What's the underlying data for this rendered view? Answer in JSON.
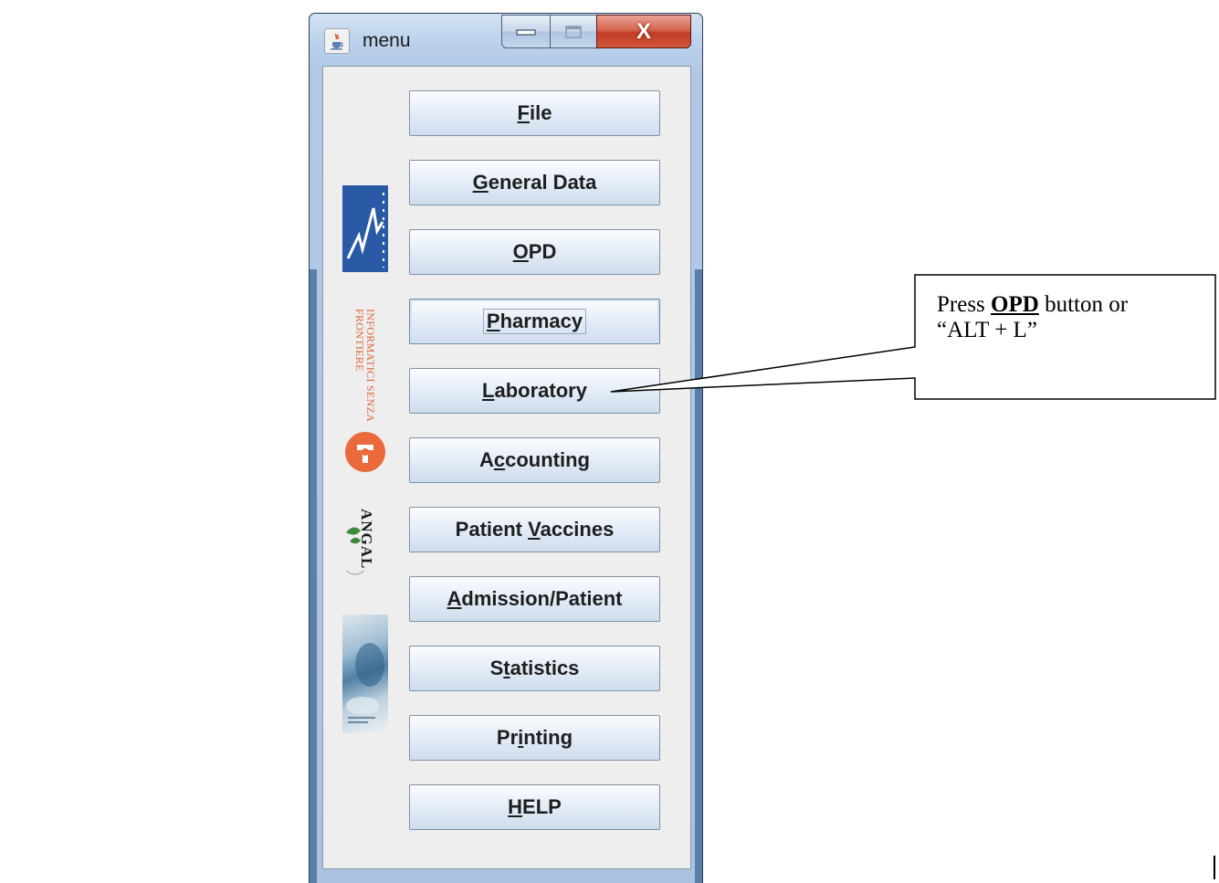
{
  "window": {
    "title": "menu",
    "icon": "java-cup-icon",
    "controls": {
      "minimize_icon": "minimize-icon",
      "maximize_icon": "maximize-icon",
      "close_glyph": "X"
    }
  },
  "sidebar_logos": [
    {
      "name": "az-logo"
    },
    {
      "name": "informatici-senza-frontiere-logo",
      "text": "INFORMATICI SENZA FRONTIERE"
    },
    {
      "name": "angal-logo",
      "text": "ANGAL"
    },
    {
      "name": "medical-photo"
    }
  ],
  "menu": [
    {
      "pre": "",
      "key": "F",
      "post": "ile"
    },
    {
      "pre": "",
      "key": "G",
      "post": "eneral Data"
    },
    {
      "pre": "",
      "key": "O",
      "post": "PD"
    },
    {
      "pre": "",
      "key": "P",
      "post": "harmacy"
    },
    {
      "pre": "",
      "key": "L",
      "post": "aboratory"
    },
    {
      "pre": "A",
      "key": "c",
      "post": "counting"
    },
    {
      "pre": "Patient ",
      "key": "V",
      "post": "accines"
    },
    {
      "pre": "",
      "key": "A",
      "post": "dmission/Patient"
    },
    {
      "pre": "S",
      "key": "t",
      "post": "atistics"
    },
    {
      "pre": "Pr",
      "key": "i",
      "post": "nting"
    },
    {
      "pre": "",
      "key": "H",
      "post": "ELP"
    }
  ],
  "callout": {
    "before": "Press ",
    "bold": "OPD",
    "after": " button or",
    "line2": "“ALT + L”"
  },
  "colors": {
    "frame": "#b2c9e6",
    "close_button": "#c03b23",
    "client_bg": "#eeeeee",
    "button_top": "#fbfcfe",
    "button_bottom": "#cfdced"
  }
}
